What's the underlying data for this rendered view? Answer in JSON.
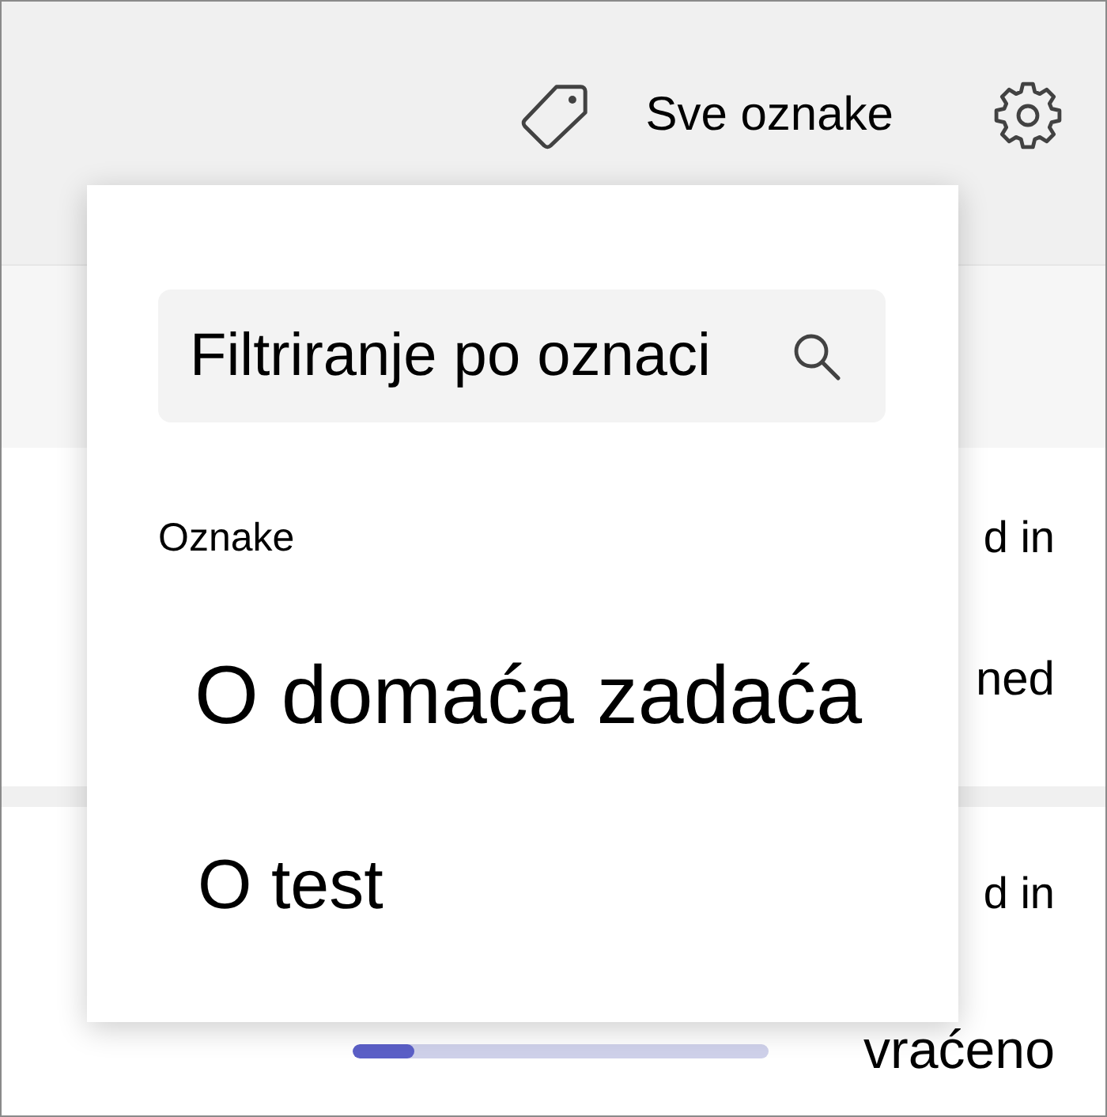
{
  "header": {
    "all_tags_label": "Sve oznake"
  },
  "tag_filter_popup": {
    "search": {
      "placeholder": "Filtriranje po oznaci"
    },
    "section_label": "Oznake",
    "items": [
      {
        "label": "O domaća zadaća"
      },
      {
        "label": "O test"
      }
    ]
  },
  "rows": [
    {
      "texts": [
        "d in",
        "ned"
      ]
    },
    {
      "texts": [
        "d in",
        "vraćeno"
      ],
      "progress": {
        "level": 0.15
      }
    }
  ]
}
